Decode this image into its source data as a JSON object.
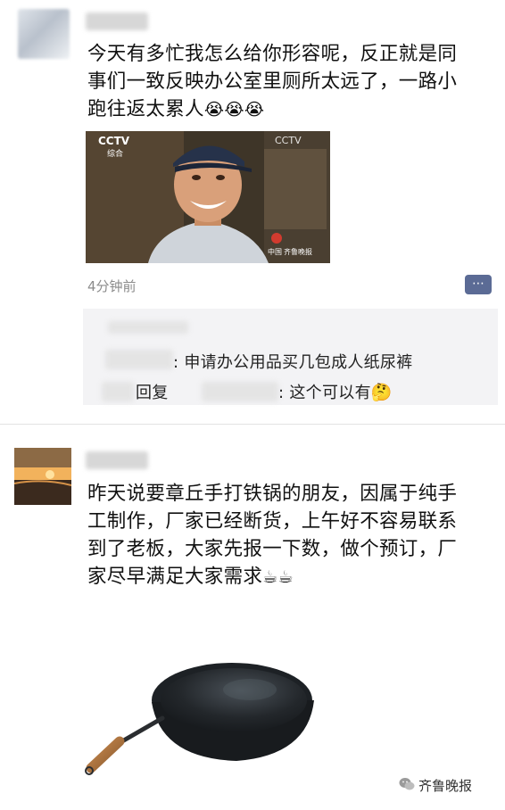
{
  "post1": {
    "text_line1": "今天有多忙我怎么给你形容呢，反正就是同",
    "text_line2": "事们一致反映办公室里厕所太远了，一路小",
    "text_line3": "跑往返太累人",
    "emojis": "😭😭😭",
    "video": {
      "logo": "CCTV",
      "logo_sub": "综合",
      "corner_logo": "CCTV",
      "badge": "中国",
      "badge_sub": "齐鲁晚报"
    },
    "time_ago": "4分钟前",
    "more_icon": "⋯",
    "comments": [
      {
        "suffix": ": 申请办公用品买几包成人纸尿裤"
      },
      {
        "prefix": "回复",
        "suffix": ": 这个可以有",
        "emoji": "🤔"
      }
    ]
  },
  "post2": {
    "text_line1": "昨天说要章丘手打铁锅的朋友，因属于纯手",
    "text_line2": "工制作，厂家已经断货，上午好不容易联系",
    "text_line3": "到了老板，大家先报一下数，做个预订，厂",
    "text_line4": "家尽早满足大家需求",
    "emojis": "☕☕"
  },
  "watermark": {
    "icon": "wechat-icon",
    "text": "齐鲁晚报"
  }
}
